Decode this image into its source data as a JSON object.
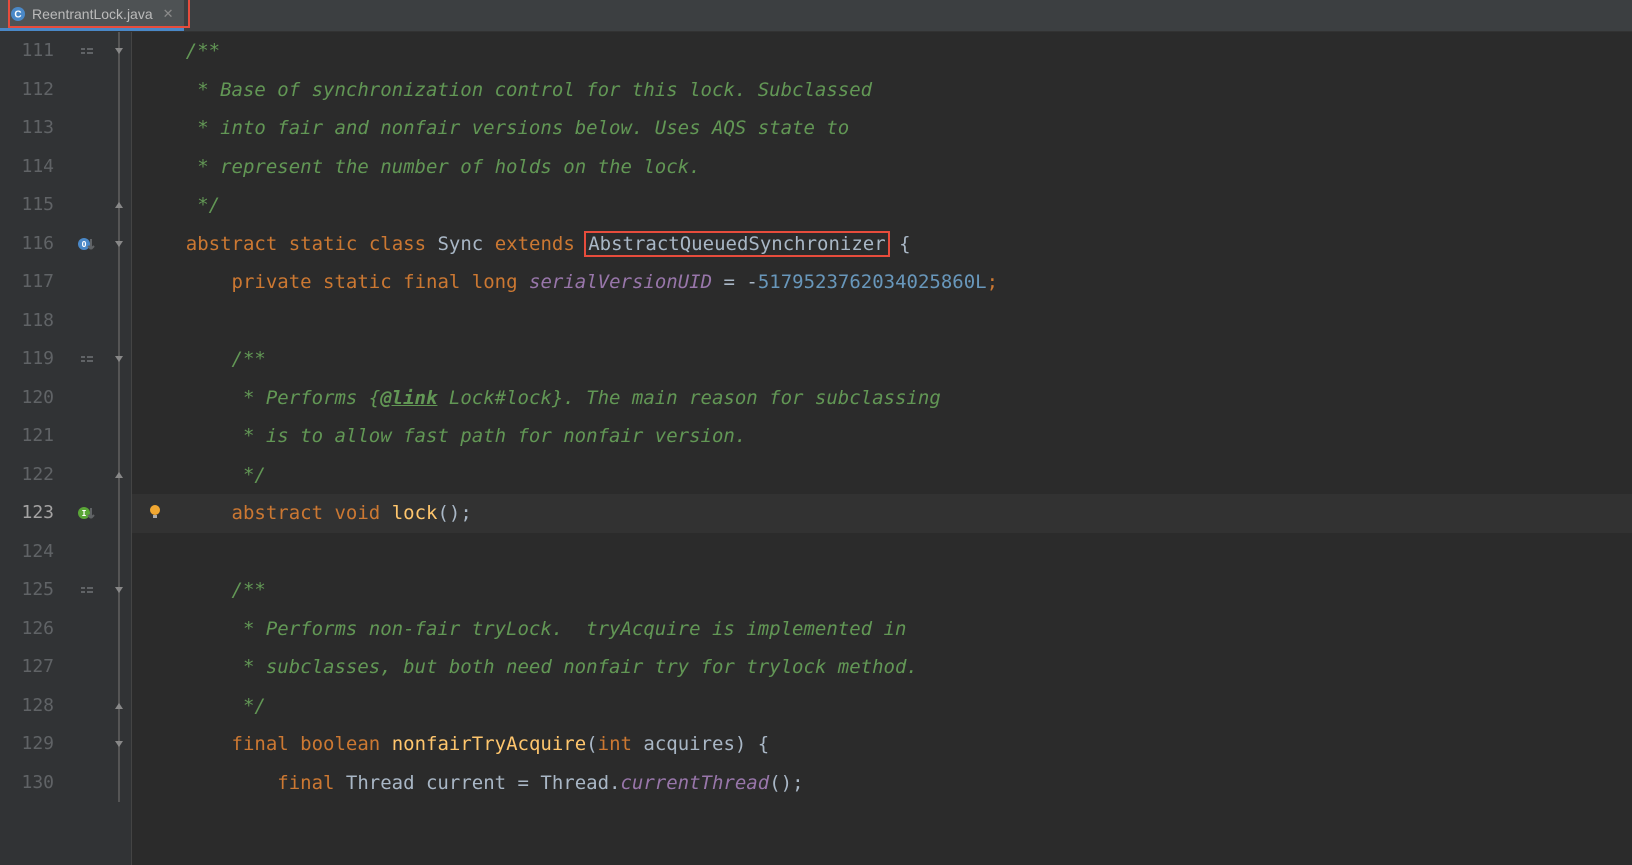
{
  "tab": {
    "filename": "ReentrantLock.java",
    "icon_label": "C"
  },
  "lines": {
    "start": 111,
    "current": 123,
    "numbers": [
      "111",
      "112",
      "113",
      "114",
      "115",
      "116",
      "117",
      "118",
      "119",
      "120",
      "121",
      "122",
      "123",
      "124",
      "125",
      "126",
      "127",
      "128",
      "129",
      "130"
    ]
  },
  "code": {
    "l111_open": "/**",
    "l112": " * Base of synchronization control for this lock. Subclassed",
    "l113": " * into fair and nonfair versions below. Uses AQS state to",
    "l114": " * represent the number of holds on the lock.",
    "l115_close": " */",
    "l116_abstract": "abstract",
    "l116_static": "static",
    "l116_class": "class",
    "l116_sync": "Sync",
    "l116_extends": "extends",
    "l116_aqs": "AbstractQueuedSynchronizer",
    "l116_brace": " {",
    "l117_private": "private",
    "l117_static": "static",
    "l117_final": "final",
    "l117_long": "long",
    "l117_field": "serialVersionUID",
    "l117_eq": " = ",
    "l117_minus": "-",
    "l117_num": "5179523762034025860L",
    "l117_semi": ";",
    "l119_open": "/**",
    "l120_a": " * Performs {",
    "l120_tag": "@link",
    "l120_b": " Lock#lock}. The main reason for subclassing",
    "l121": " * is to allow fast path for nonfair version.",
    "l122_close": " */",
    "l123_abstract": "abstract",
    "l123_void": "void",
    "l123_method": "lock",
    "l123_paren": "();",
    "l125_open": "/**",
    "l126": " * Performs non-fair tryLock.  tryAcquire is implemented in",
    "l127": " * subclasses, but both need nonfair try for trylock method.",
    "l128_close": " */",
    "l129_final": "final",
    "l129_boolean": "boolean",
    "l129_method": "nonfairTryAcquire",
    "l129_lp": "(",
    "l129_int": "int",
    "l129_param": " acquires",
    "l129_rp": ")",
    "l129_brace": " {",
    "l130_final": "final",
    "l130_thread": " Thread current = Thread.",
    "l130_ct": "currentThread",
    "l130_end": "();"
  }
}
